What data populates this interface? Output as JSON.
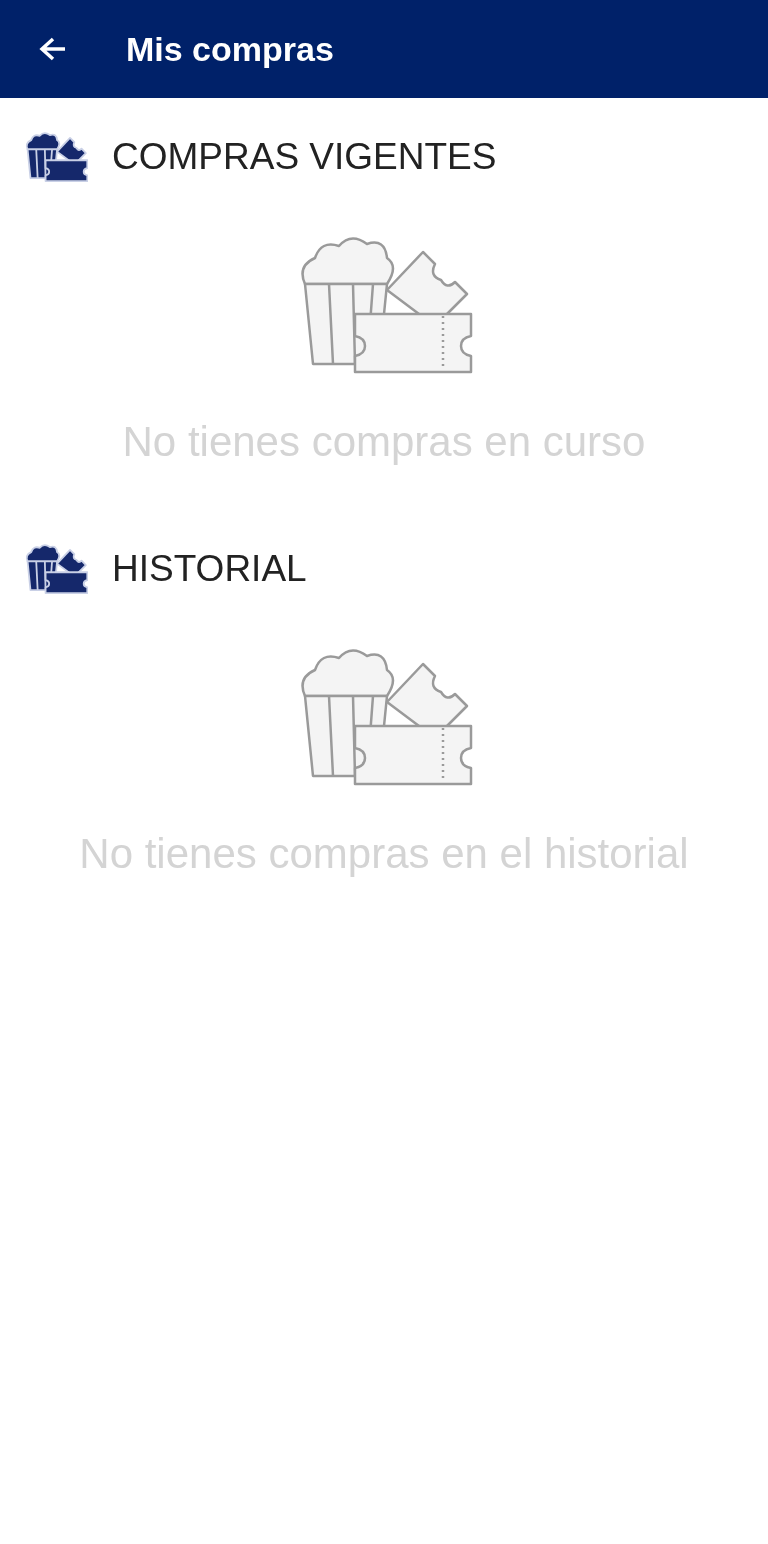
{
  "app_bar": {
    "title": "Mis compras"
  },
  "sections": [
    {
      "title": "COMPRAS VIGENTES",
      "empty_message": "No tienes compras en curso"
    },
    {
      "title": "HISTORIAL",
      "empty_message": "No tienes compras en el historial"
    }
  ]
}
